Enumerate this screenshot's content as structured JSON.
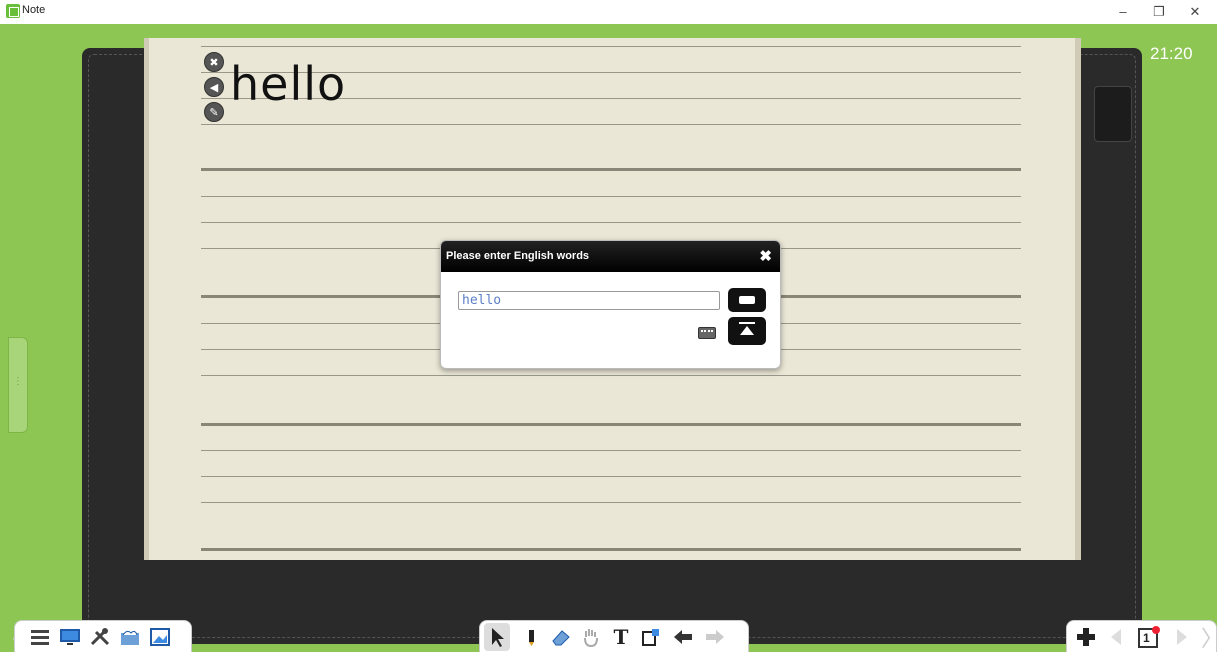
{
  "window": {
    "title": "Note",
    "minimize_label": "–",
    "restore_label": "❐",
    "close_label": "✕"
  },
  "clock": "21:20",
  "note": {
    "word": "hello"
  },
  "dialog": {
    "title": "Please enter English words",
    "input_value": "hello"
  },
  "toolbar_left": {
    "icons": [
      "menu-icon",
      "screen-icon",
      "tools-icon",
      "cloud-photo-icon",
      "image-icon"
    ]
  },
  "toolbar_center": {
    "icons": [
      "pointer-icon",
      "pen-icon",
      "eraser-icon",
      "hand-icon",
      "text-icon",
      "shape-icon",
      "undo-icon",
      "redo-icon"
    ],
    "text_tool_label": "T"
  },
  "toolbar_right": {
    "icons": [
      "add-page-icon",
      "prev-page-icon",
      "page-icon",
      "next-page-icon"
    ],
    "page_number": "1"
  },
  "colors": {
    "frame": "#8dc653",
    "board": "#2a2a2a",
    "paper": "#eae7d6",
    "dialog_header": "#000000"
  }
}
